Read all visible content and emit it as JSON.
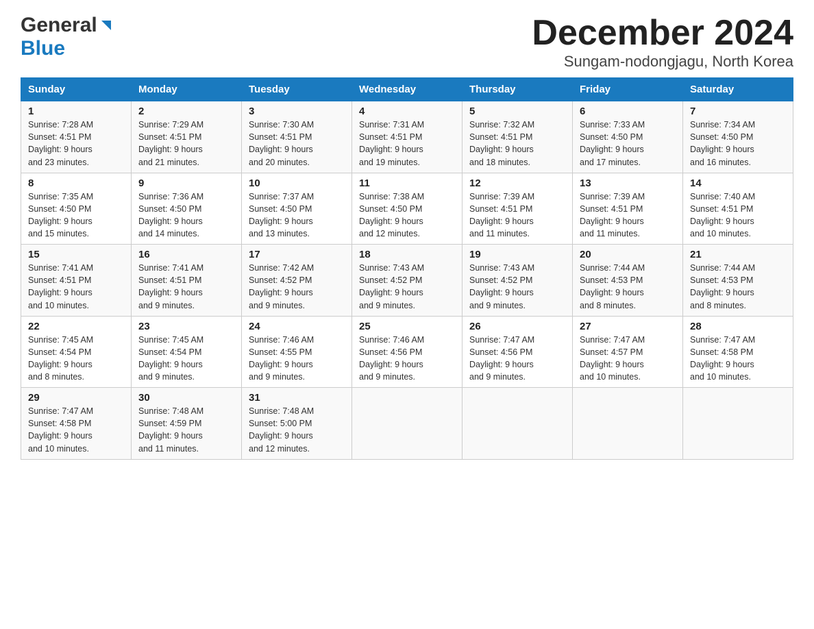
{
  "logo": {
    "general": "General",
    "blue": "Blue"
  },
  "title": "December 2024",
  "subtitle": "Sungam-nodongjagu, North Korea",
  "weekdays": [
    "Sunday",
    "Monday",
    "Tuesday",
    "Wednesday",
    "Thursday",
    "Friday",
    "Saturday"
  ],
  "weeks": [
    [
      {
        "day": "1",
        "sunrise": "7:28 AM",
        "sunset": "4:51 PM",
        "daylight": "9 hours and 23 minutes."
      },
      {
        "day": "2",
        "sunrise": "7:29 AM",
        "sunset": "4:51 PM",
        "daylight": "9 hours and 21 minutes."
      },
      {
        "day": "3",
        "sunrise": "7:30 AM",
        "sunset": "4:51 PM",
        "daylight": "9 hours and 20 minutes."
      },
      {
        "day": "4",
        "sunrise": "7:31 AM",
        "sunset": "4:51 PM",
        "daylight": "9 hours and 19 minutes."
      },
      {
        "day": "5",
        "sunrise": "7:32 AM",
        "sunset": "4:51 PM",
        "daylight": "9 hours and 18 minutes."
      },
      {
        "day": "6",
        "sunrise": "7:33 AM",
        "sunset": "4:50 PM",
        "daylight": "9 hours and 17 minutes."
      },
      {
        "day": "7",
        "sunrise": "7:34 AM",
        "sunset": "4:50 PM",
        "daylight": "9 hours and 16 minutes."
      }
    ],
    [
      {
        "day": "8",
        "sunrise": "7:35 AM",
        "sunset": "4:50 PM",
        "daylight": "9 hours and 15 minutes."
      },
      {
        "day": "9",
        "sunrise": "7:36 AM",
        "sunset": "4:50 PM",
        "daylight": "9 hours and 14 minutes."
      },
      {
        "day": "10",
        "sunrise": "7:37 AM",
        "sunset": "4:50 PM",
        "daylight": "9 hours and 13 minutes."
      },
      {
        "day": "11",
        "sunrise": "7:38 AM",
        "sunset": "4:50 PM",
        "daylight": "9 hours and 12 minutes."
      },
      {
        "day": "12",
        "sunrise": "7:39 AM",
        "sunset": "4:51 PM",
        "daylight": "9 hours and 11 minutes."
      },
      {
        "day": "13",
        "sunrise": "7:39 AM",
        "sunset": "4:51 PM",
        "daylight": "9 hours and 11 minutes."
      },
      {
        "day": "14",
        "sunrise": "7:40 AM",
        "sunset": "4:51 PM",
        "daylight": "9 hours and 10 minutes."
      }
    ],
    [
      {
        "day": "15",
        "sunrise": "7:41 AM",
        "sunset": "4:51 PM",
        "daylight": "9 hours and 10 minutes."
      },
      {
        "day": "16",
        "sunrise": "7:41 AM",
        "sunset": "4:51 PM",
        "daylight": "9 hours and 9 minutes."
      },
      {
        "day": "17",
        "sunrise": "7:42 AM",
        "sunset": "4:52 PM",
        "daylight": "9 hours and 9 minutes."
      },
      {
        "day": "18",
        "sunrise": "7:43 AM",
        "sunset": "4:52 PM",
        "daylight": "9 hours and 9 minutes."
      },
      {
        "day": "19",
        "sunrise": "7:43 AM",
        "sunset": "4:52 PM",
        "daylight": "9 hours and 9 minutes."
      },
      {
        "day": "20",
        "sunrise": "7:44 AM",
        "sunset": "4:53 PM",
        "daylight": "9 hours and 8 minutes."
      },
      {
        "day": "21",
        "sunrise": "7:44 AM",
        "sunset": "4:53 PM",
        "daylight": "9 hours and 8 minutes."
      }
    ],
    [
      {
        "day": "22",
        "sunrise": "7:45 AM",
        "sunset": "4:54 PM",
        "daylight": "9 hours and 8 minutes."
      },
      {
        "day": "23",
        "sunrise": "7:45 AM",
        "sunset": "4:54 PM",
        "daylight": "9 hours and 9 minutes."
      },
      {
        "day": "24",
        "sunrise": "7:46 AM",
        "sunset": "4:55 PM",
        "daylight": "9 hours and 9 minutes."
      },
      {
        "day": "25",
        "sunrise": "7:46 AM",
        "sunset": "4:56 PM",
        "daylight": "9 hours and 9 minutes."
      },
      {
        "day": "26",
        "sunrise": "7:47 AM",
        "sunset": "4:56 PM",
        "daylight": "9 hours and 9 minutes."
      },
      {
        "day": "27",
        "sunrise": "7:47 AM",
        "sunset": "4:57 PM",
        "daylight": "9 hours and 10 minutes."
      },
      {
        "day": "28",
        "sunrise": "7:47 AM",
        "sunset": "4:58 PM",
        "daylight": "9 hours and 10 minutes."
      }
    ],
    [
      {
        "day": "29",
        "sunrise": "7:47 AM",
        "sunset": "4:58 PM",
        "daylight": "9 hours and 10 minutes."
      },
      {
        "day": "30",
        "sunrise": "7:48 AM",
        "sunset": "4:59 PM",
        "daylight": "9 hours and 11 minutes."
      },
      {
        "day": "31",
        "sunrise": "7:48 AM",
        "sunset": "5:00 PM",
        "daylight": "9 hours and 12 minutes."
      },
      null,
      null,
      null,
      null
    ]
  ],
  "labels": {
    "sunrise": "Sunrise:",
    "sunset": "Sunset:",
    "daylight": "Daylight:"
  }
}
